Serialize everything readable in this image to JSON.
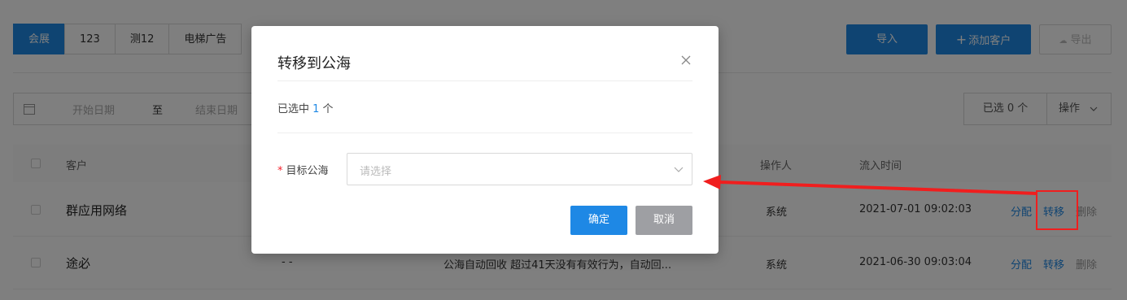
{
  "tabs": [
    "会展",
    "123",
    "测12",
    "电梯广告"
  ],
  "toolbar": {
    "import": "导入",
    "add_customer": "添加客户",
    "export": "导出"
  },
  "filter": {
    "start_placeholder": "开始日期",
    "to": "至",
    "end_placeholder": "结束日期"
  },
  "selection": {
    "count_label": "已选 0 个",
    "ops_label": "操作"
  },
  "table": {
    "headers": {
      "customer": "客户",
      "operator": "操作人",
      "inflow_time": "流入时间"
    },
    "rows": [
      {
        "name": "群应用网络",
        "col2": "",
        "reason": "",
        "operator": "系统",
        "time": "2021-07-01 09:02:03",
        "actions": [
          "分配",
          "转移",
          "删除"
        ]
      },
      {
        "name": "途必",
        "col2": "- -",
        "reason": "公海自动回收 超过41天没有有效行为，自动回...",
        "operator": "系统",
        "time": "2021-06-30 09:03:04",
        "actions": [
          "分配",
          "转移",
          "删除"
        ]
      }
    ]
  },
  "modal": {
    "title": "转移到公海",
    "selected_prefix": "已选中 ",
    "selected_count": "1",
    "selected_suffix": " 个",
    "required_mark": "*",
    "field_label": "目标公海",
    "field_placeholder": "请选择",
    "confirm": "确定",
    "cancel": "取消"
  },
  "colors": {
    "accent": "#1e88e5",
    "annotation": "#f01e1e",
    "cancel_bg": "#9e9fa3"
  },
  "icons": [
    "calendar-icon",
    "plus-icon",
    "cloud-download-icon",
    "chevron-down-icon",
    "close-icon",
    "annotation-arrow"
  ]
}
